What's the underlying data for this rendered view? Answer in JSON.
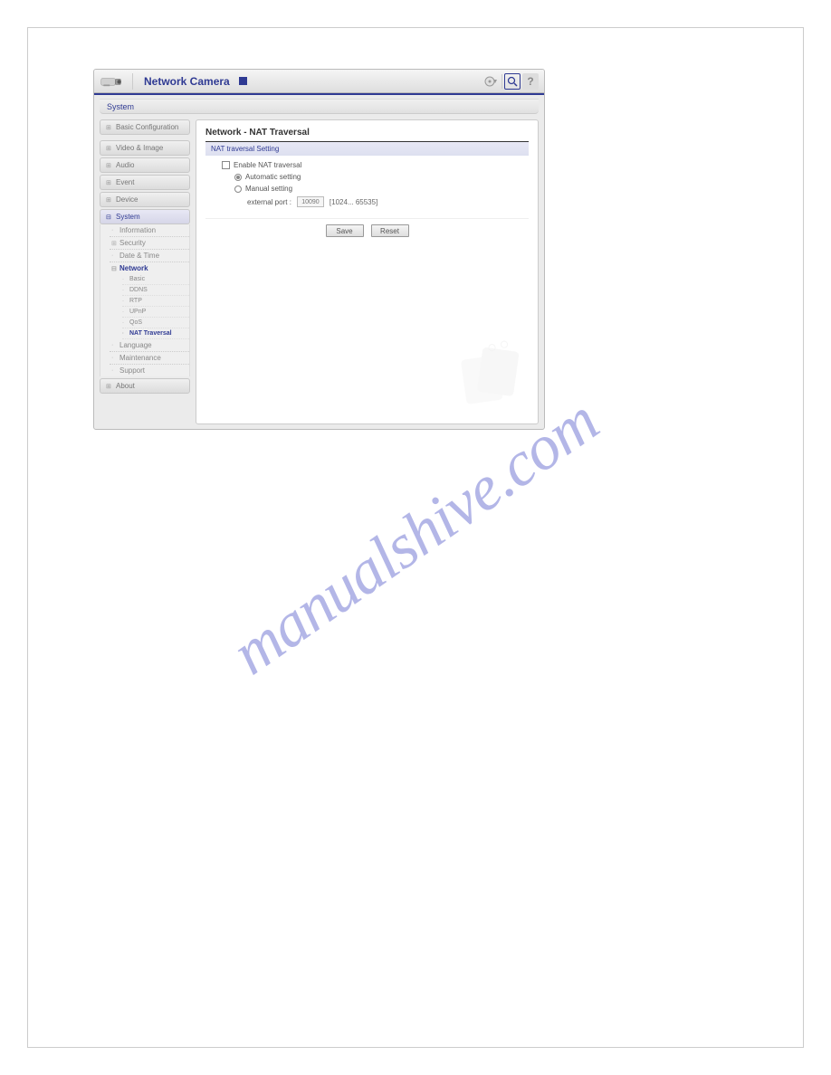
{
  "header": {
    "title": "Network Camera"
  },
  "breadcrumb": {
    "text": "System"
  },
  "sidebar": {
    "basic_config": "Basic Configuration",
    "video_image": "Video & Image",
    "audio": "Audio",
    "event": "Event",
    "device": "Device",
    "system": "System",
    "about": "About",
    "system_children": {
      "information": "Information",
      "security": "Security",
      "date_time": "Date & Time",
      "network": "Network",
      "language": "Language",
      "maintenance": "Maintenance",
      "support": "Support"
    },
    "network_children": {
      "basic": "Basic",
      "ddns": "DDNS",
      "rtp": "RTP",
      "upnp": "UPnP",
      "qos": "QoS",
      "nat": "NAT Traversal"
    }
  },
  "panel": {
    "title": "Network - NAT Traversal",
    "subtitle": "NAT traversal Setting",
    "enable_label": "Enable NAT traversal",
    "auto_label": "Automatic setting",
    "manual_label": "Manual setting",
    "port_label": "external port :",
    "port_value": "10090",
    "port_hint": "[1024... 65535]"
  },
  "buttons": {
    "save": "Save",
    "reset": "Reset"
  },
  "watermark": "manualshive.com"
}
